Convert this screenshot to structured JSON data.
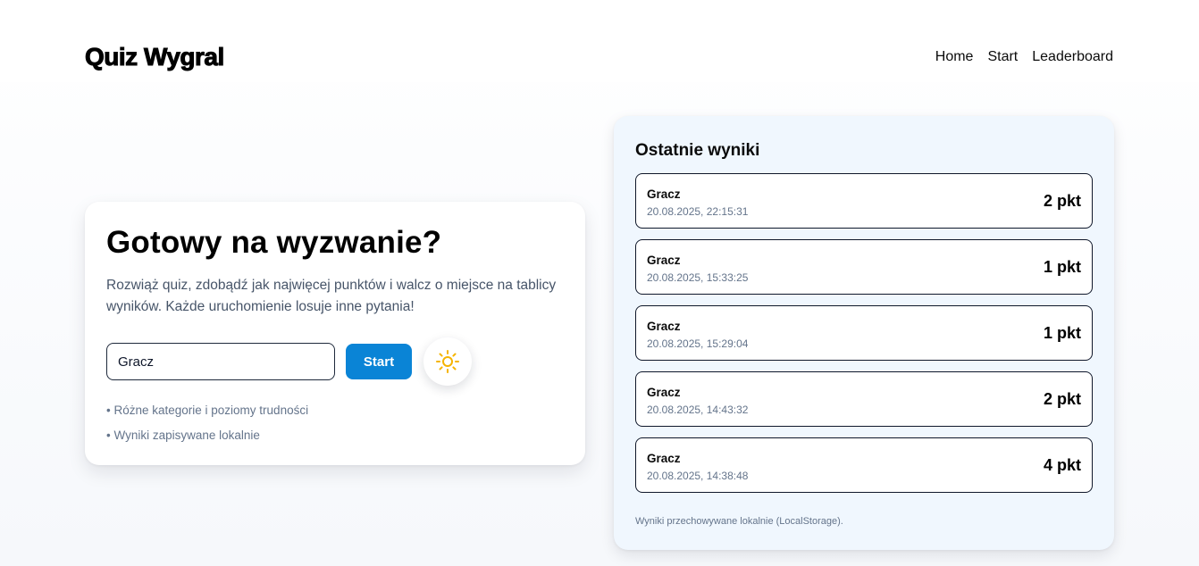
{
  "header": {
    "brand": "Quiz Wygral",
    "nav": [
      "Home",
      "Start",
      "Leaderboard"
    ]
  },
  "hero": {
    "title": "Gotowy na wyzwanie?",
    "description": "Rozwiąż quiz, zdobądź jak najwięcej punktów i walcz o miejsce na tablicy wyników. Każde uruchomienie losuje inne pytania!",
    "name_value": "Gracz",
    "start_label": "Start",
    "theme_icon": "sun-icon",
    "features": [
      "• Różne kategorie i poziomy trudności",
      "• Wyniki zapisywane lokalnie"
    ]
  },
  "results_panel": {
    "title": "Ostatnie wyniki",
    "results": [
      {
        "name": "Gracz",
        "date": "20.08.2025, 22:15:31",
        "score": "2 pkt"
      },
      {
        "name": "Gracz",
        "date": "20.08.2025, 15:33:25",
        "score": "1 pkt"
      },
      {
        "name": "Gracz",
        "date": "20.08.2025, 15:29:04",
        "score": "1 pkt"
      },
      {
        "name": "Gracz",
        "date": "20.08.2025, 14:43:32",
        "score": "2 pkt"
      },
      {
        "name": "Gracz",
        "date": "20.08.2025, 14:38:48",
        "score": "4 pkt"
      }
    ],
    "note": "Wyniki przechowywane lokalnie (LocalStorage)."
  },
  "colors": {
    "accent": "#0a84d6",
    "sun": "#f5b400",
    "panel_bg": "#f0f7fe"
  }
}
